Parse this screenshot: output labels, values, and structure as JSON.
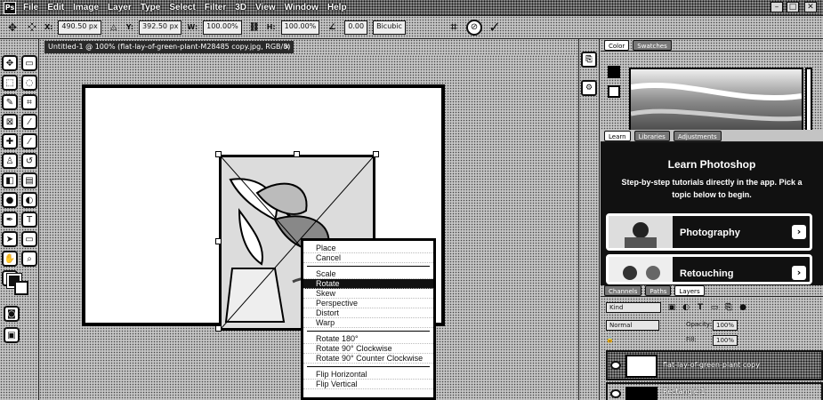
{
  "menubar": {
    "logo": "Ps",
    "items": [
      "File",
      "Edit",
      "Image",
      "Layer",
      "Type",
      "Select",
      "Filter",
      "3D",
      "View",
      "Window",
      "Help"
    ],
    "window_controls": [
      "–",
      "□",
      "✕"
    ]
  },
  "options": {
    "x_label": "X:",
    "x_value": "490.50 px",
    "y_label": "Y:",
    "y_value": "392.50 px",
    "w_label": "W:",
    "w_value": "100.00%",
    "h_label": "H:",
    "h_value": "100.00%",
    "angle_value": "0.00",
    "interp": "Bicubic",
    "cancel_icon": "cancel-icon",
    "commit_icon": "check-icon"
  },
  "document": {
    "tab_title": "Untitled-1 @ 100% (flat-lay-of-green-plant-M28485 copy.jpg, RGB/8)",
    "tab_close": "×"
  },
  "context_menu": {
    "items_group1": [
      "Place",
      "Cancel"
    ],
    "items_group2": [
      "Scale",
      "Rotate",
      "Skew",
      "Perspective",
      "Distort",
      "Warp"
    ],
    "items_group3": [
      "Rotate 180°",
      "Rotate 90° Clockwise",
      "Rotate 90° Counter Clockwise"
    ],
    "items_group4": [
      "Flip Horizontal",
      "Flip Vertical"
    ],
    "highlighted": "Rotate"
  },
  "panels": {
    "color_tabs": [
      "Color",
      "Swatches"
    ],
    "learn_tabs": [
      "Learn",
      "Libraries",
      "Adjustments"
    ],
    "learn_title": "Learn Photoshop",
    "learn_subtitle": "Step-by-step tutorials directly in the app. Pick a topic below to begin.",
    "learn_cards": [
      "Photography",
      "Retouching"
    ],
    "layers_tabs": [
      "Layers",
      "Channels",
      "Paths"
    ],
    "layers_kind": "Kind",
    "layers_blend": "Normal",
    "layers_opacity_label": "Opacity:",
    "layers_opacity": "100%",
    "layers_fill_label": "Fill:",
    "layers_fill": "100%",
    "layer_names": [
      "flat-lay-of-green-plant copy",
      "Rectangle 1"
    ]
  },
  "colors": {
    "foreground": "#000000",
    "background": "#ffffff"
  }
}
